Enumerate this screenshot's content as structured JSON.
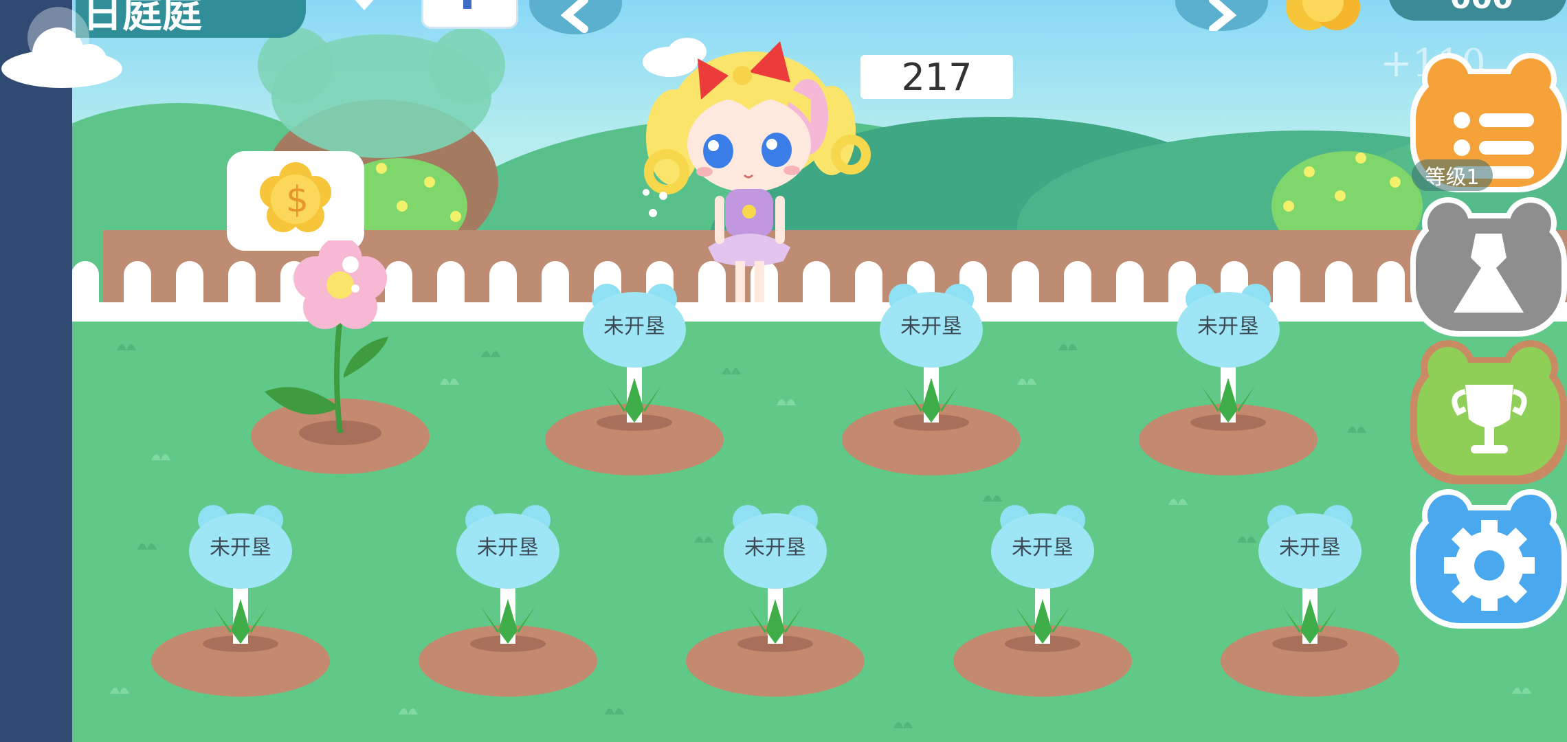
{
  "top_bar": {
    "title_partial": "日庭庭",
    "coin_value_partial": "000"
  },
  "score": "217",
  "floating_bonus": "+110",
  "level_badge": "等级1",
  "plots_row1": [
    {
      "label": "未开垦"
    },
    {
      "label": "未开垦"
    },
    {
      "label": "未开垦"
    }
  ],
  "plots_row2": [
    {
      "label": "未开垦"
    },
    {
      "label": "未开垦"
    },
    {
      "label": "未开垦"
    },
    {
      "label": "未开垦"
    },
    {
      "label": "未开垦"
    }
  ],
  "side_buttons": [
    {
      "icon": "list-icon",
      "color": "#f6a23a"
    },
    {
      "icon": "dress-icon",
      "color": "#8e8e8e"
    },
    {
      "icon": "trophy-icon",
      "color": "#8fcf58"
    },
    {
      "icon": "gear-icon",
      "color": "#4aa8ef"
    }
  ],
  "colors": {
    "grass": "#60c987",
    "fence": "#ffffff",
    "wall": "#c08a72",
    "sign": "#9ee6f6"
  }
}
